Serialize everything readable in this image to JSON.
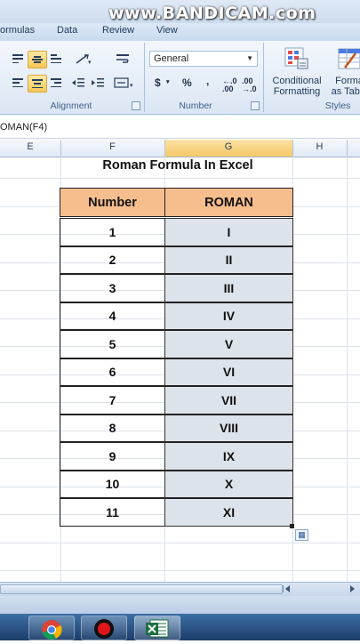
{
  "watermark": "www.BANDICAM.com",
  "ribbon_tabs": [
    "ormulas",
    "Data",
    "Review",
    "View"
  ],
  "ribbon": {
    "alignment_label": "Alignment",
    "number_label": "Number",
    "styles_label": "Styles",
    "number_format_value": "General",
    "currency_symbol": "$",
    "percent_symbol": "%",
    "comma_symbol": ",",
    "increase_decimal": "←.0 .00",
    "decrease_decimal": ".00 →.0",
    "conditional_formatting_line1": "Conditional",
    "conditional_formatting_line2": "Formatting",
    "format_as_table_line1": "Forma",
    "format_as_table_line2": "as Table"
  },
  "formula_bar_text": "OMAN(F4)",
  "columns": [
    "E",
    "F",
    "G",
    "H"
  ],
  "sheet": {
    "title": "Roman Formula In Excel",
    "headers": [
      "Number",
      "ROMAN"
    ],
    "rows": [
      {
        "number": "1",
        "roman": "I"
      },
      {
        "number": "2",
        "roman": "II"
      },
      {
        "number": "3",
        "roman": "III"
      },
      {
        "number": "4",
        "roman": "IV"
      },
      {
        "number": "5",
        "roman": "V"
      },
      {
        "number": "6",
        "roman": "VI"
      },
      {
        "number": "7",
        "roman": "VII"
      },
      {
        "number": "8",
        "roman": "VIII"
      },
      {
        "number": "9",
        "roman": "IX"
      },
      {
        "number": "10",
        "roman": "X"
      },
      {
        "number": "11",
        "roman": "XI"
      }
    ]
  },
  "colors": {
    "header_fill": "#f7be8d",
    "selection_fill": "#dde3ea",
    "selected_column_header": "#f6c866",
    "taskbar": "#1d3d69"
  },
  "taskbar_icons": [
    "chrome-icon",
    "bandicam-record-icon",
    "excel-icon"
  ]
}
